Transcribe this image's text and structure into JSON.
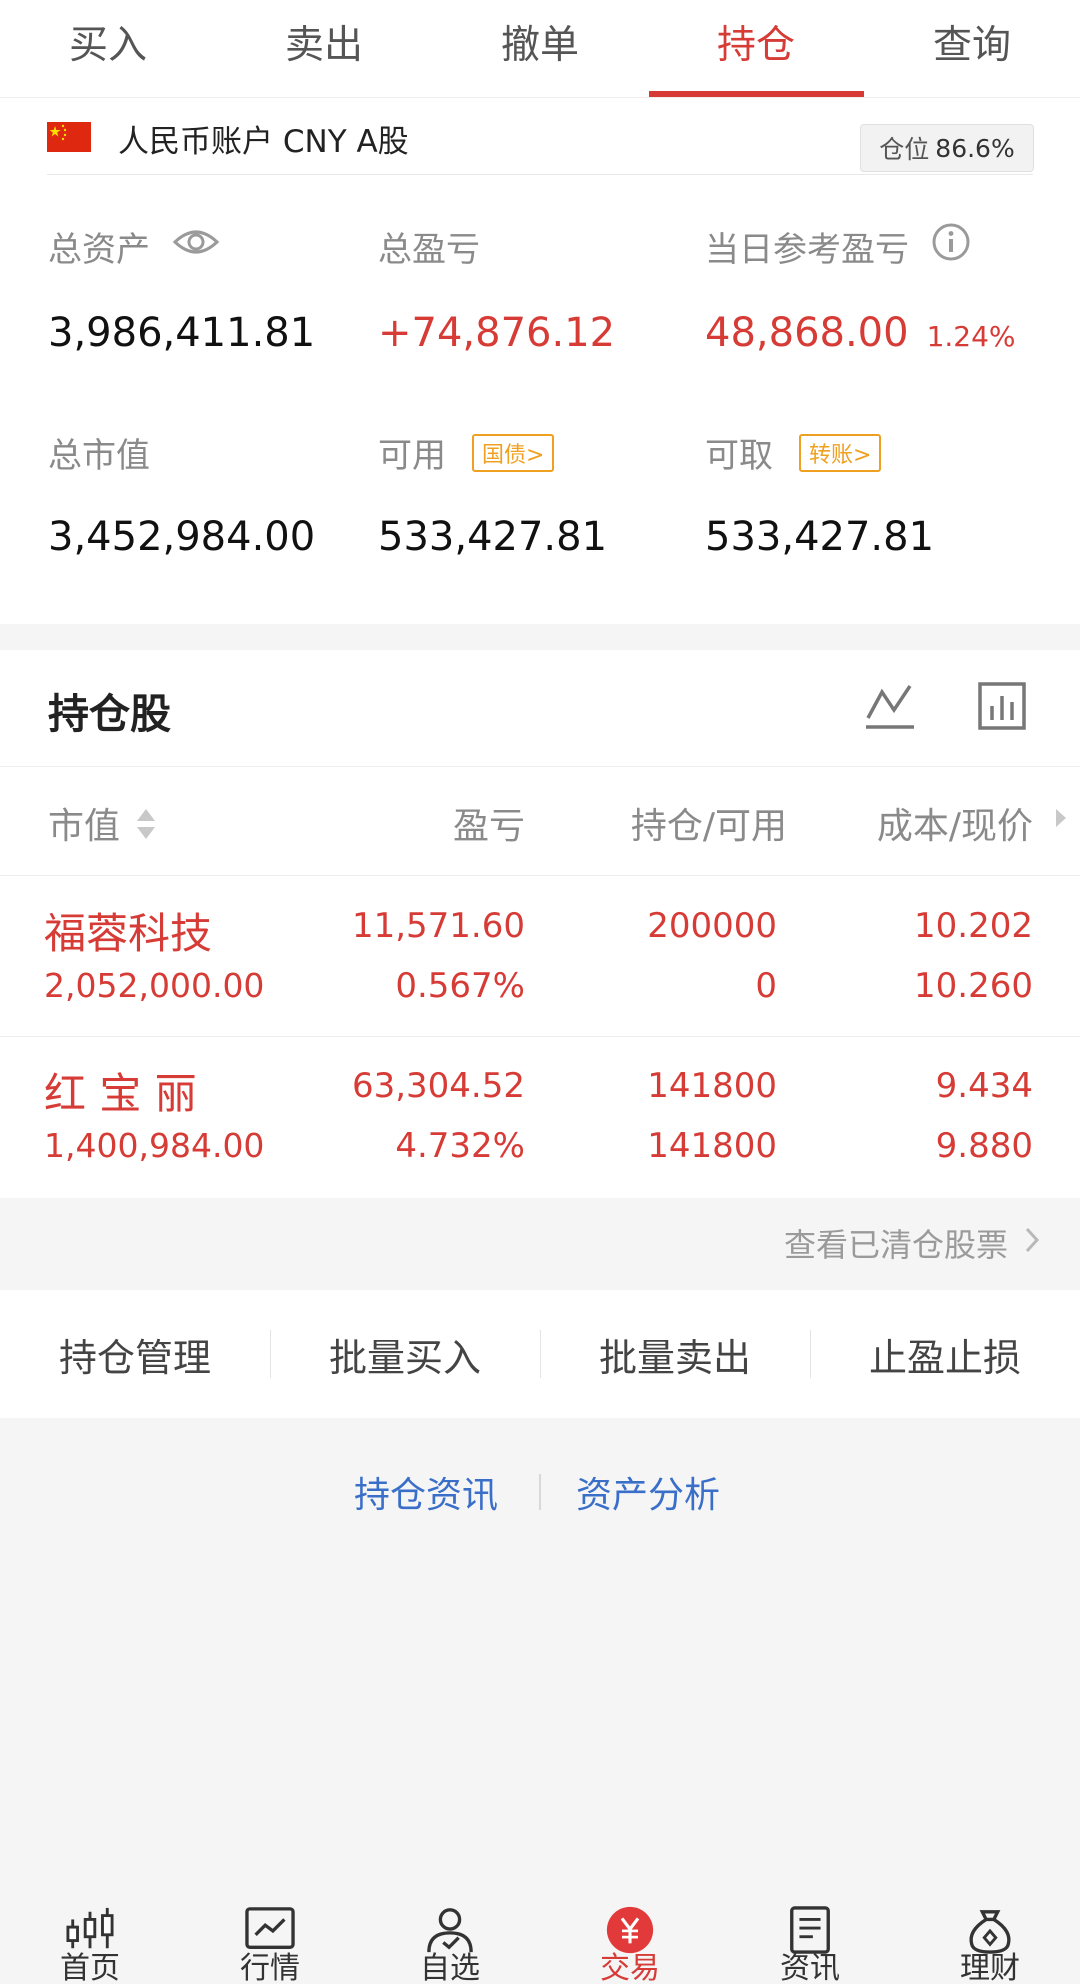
{
  "tabs": [
    {
      "label": "买入"
    },
    {
      "label": "卖出"
    },
    {
      "label": "撤单"
    },
    {
      "label": "持仓",
      "active": true
    },
    {
      "label": "查询"
    }
  ],
  "account": {
    "name": "人民币账户 CNY A股",
    "position_label": "仓位",
    "position_value": "86.6%"
  },
  "stats": {
    "total_assets_label": "总资产",
    "total_assets_value": "3,986,411.81",
    "total_pl_label": "总盈亏",
    "total_pl_value": "+74,876.12",
    "daily_pl_label": "当日参考盈亏",
    "daily_pl_value": "48,868.00",
    "daily_pl_pct": "1.24%",
    "market_value_label": "总市值",
    "market_value_value": "3,452,984.00",
    "available_label": "可用",
    "available_tag": "国债>",
    "available_value": "533,427.81",
    "withdrawable_label": "可取",
    "withdrawable_tag": "转账>",
    "withdrawable_value": "533,427.81"
  },
  "holdings": {
    "title": "持仓股",
    "columns": [
      "市值",
      "盈亏",
      "持仓/可用",
      "成本/现价"
    ],
    "rows": [
      {
        "name": "福蓉科技",
        "market_value": "2,052,000.00",
        "pl": "11,571.60",
        "pl_pct": "0.567%",
        "position": "200000",
        "available": "0",
        "cost": "10.202",
        "price": "10.260"
      },
      {
        "name": "红 宝 丽",
        "market_value": "1,400,984.00",
        "pl": "63,304.52",
        "pl_pct": "4.732%",
        "position": "141800",
        "available": "141800",
        "cost": "9.434",
        "price": "9.880"
      }
    ]
  },
  "view_cleared": "查看已清仓股票",
  "actions": [
    "持仓管理",
    "批量买入",
    "批量卖出",
    "止盈止损"
  ],
  "links": [
    "持仓资讯",
    "资产分析"
  ],
  "nav": [
    {
      "label": "首页",
      "icon": "candlestick-icon"
    },
    {
      "label": "行情",
      "icon": "chart-line-icon"
    },
    {
      "label": "自选",
      "icon": "user-check-icon"
    },
    {
      "label": "交易",
      "icon": "yuan-icon",
      "active": true
    },
    {
      "label": "资讯",
      "icon": "document-icon"
    },
    {
      "label": "理财",
      "icon": "money-bag-icon"
    }
  ],
  "colors": {
    "accent": "#d63b36",
    "link": "#3a6fc9",
    "tag": "#f0a020"
  }
}
